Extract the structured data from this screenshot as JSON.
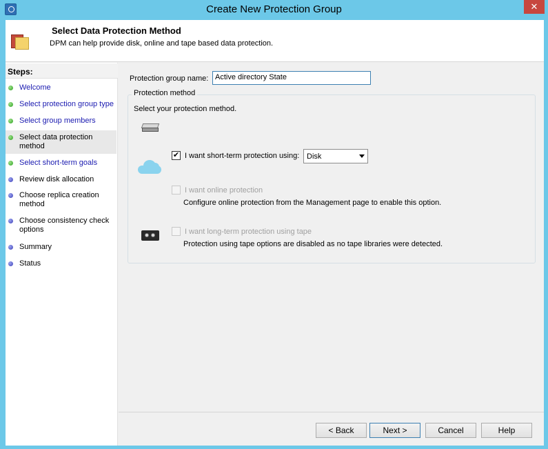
{
  "window": {
    "title": "Create New Protection Group",
    "close_symbol": "✕"
  },
  "header": {
    "title": "Select Data Protection Method",
    "description": "DPM can help provide disk, online and tape based data protection."
  },
  "sidebar": {
    "heading": "Steps:",
    "items": [
      {
        "label": "Welcome"
      },
      {
        "label": "Select protection group type"
      },
      {
        "label": "Select group members"
      },
      {
        "label": "Select data protection method"
      },
      {
        "label": "Select short-term goals"
      },
      {
        "label": "Review disk allocation"
      },
      {
        "label": "Choose replica creation method"
      },
      {
        "label": "Choose consistency check options"
      },
      {
        "label": "Summary"
      },
      {
        "label": "Status"
      }
    ]
  },
  "form": {
    "group_name_label": "Protection group name:",
    "group_name_value": "Active directory State",
    "method_legend": "Protection method",
    "method_instruction": "Select your protection method.",
    "short_term": {
      "label": "I want short-term protection using:",
      "checked_mark": "✔",
      "selected": "Disk"
    },
    "online": {
      "label": "I want online protection",
      "note": "Configure online protection from the Management page to enable this option."
    },
    "tape": {
      "label": "I want long-term protection using tape",
      "note": "Protection using tape options are disabled as no tape libraries were detected."
    }
  },
  "buttons": {
    "back": "< Back",
    "next": "Next >",
    "cancel": "Cancel",
    "help": "Help"
  },
  "colors": {
    "titlebar": "#6cc8e8",
    "step_done": "#2ca11f",
    "step_todo": "#3b3fb8",
    "link": "#1a1ab0"
  }
}
